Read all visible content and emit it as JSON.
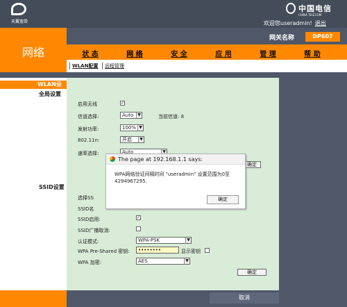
{
  "header": {
    "left_brand": "天翼宽带",
    "right_brand": "中国电信",
    "right_brand_sub": "CHINA TELECOM",
    "welcome_text": "欢迎您useradmin!",
    "logout": "退出",
    "section_title": "网络",
    "gateway_label": "网关名称",
    "gateway_value": "DP607"
  },
  "main_nav": [
    "状 态",
    "网 络",
    "安 全",
    "应 用",
    "管 理",
    "帮 助"
  ],
  "sub_nav": [
    "WLAN配置",
    "远程管理"
  ],
  "sidebar": {
    "active_item": "WLAN设置",
    "global_section": "全局设置",
    "ssid_section": "SSID设置"
  },
  "global_settings": {
    "enable_wireless_label": "启用无线",
    "enable_wireless_checked": "✓",
    "channel_label": "信道选择:",
    "channel_value": "Auto",
    "current_channel": "当前信道: 8",
    "tx_power_label": "发射功率:",
    "tx_power_value": "100%",
    "mode_label": "802.11n:",
    "mode_value": "开启",
    "rate_label": "速率选择:",
    "rate_value": "Auto",
    "confirm_label": "确定"
  },
  "ssid_settings": {
    "select_ssid_label": "选择SS",
    "ssid_name_label": "SSID名",
    "ssid_enable_label": "SSID启用:",
    "ssid_enable_checked": "✓",
    "broadcast_label": "SSID广播取消:",
    "auth_mode_label": "认证模式:",
    "auth_mode_value": "WPA-PSK",
    "psk_label": "WPA Pre-Shared 密钥:",
    "psk_value": "••••••••",
    "show_key_label": "显示密钥",
    "encryption_label": "WPA 加密:",
    "encryption_value": "AES",
    "confirm_label": "确定"
  },
  "dialog": {
    "title": "The page at 192.168.1.1 says:",
    "message": "WPA网络验证间隔时间 \"useradmin\" 设置范围为0至4294967295.",
    "ok_label": "确定"
  },
  "footer": {
    "cancel_label": "取消"
  },
  "colors": {
    "orange": "#ff8800",
    "gray": "#4f5769",
    "content_green": "#d8ecd8"
  }
}
